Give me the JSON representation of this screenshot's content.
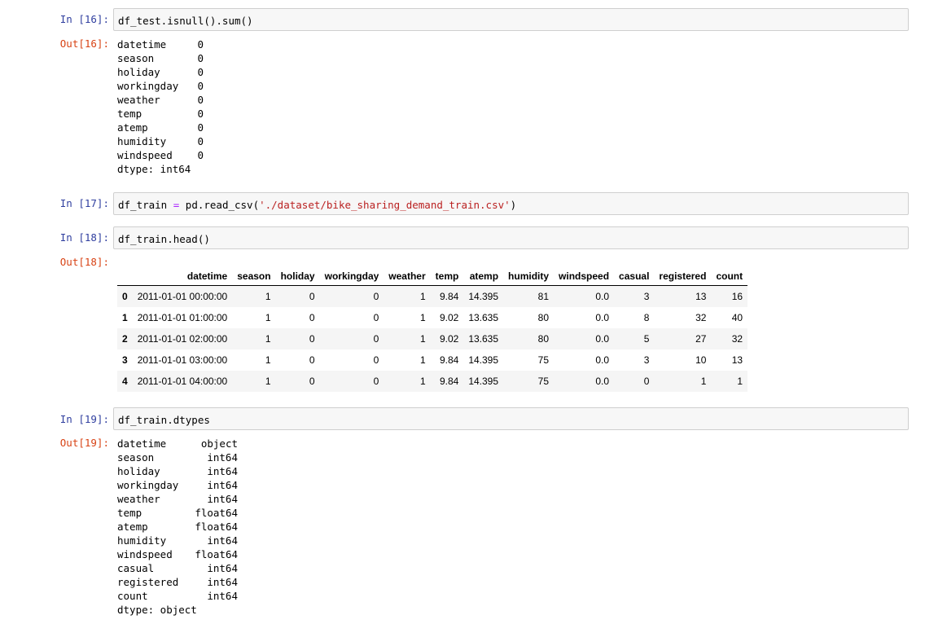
{
  "cells": {
    "c16": {
      "in_prompt": "In [16]:",
      "code": "df_test.isnull().sum()",
      "out_prompt": "Out[16]:",
      "rows": [
        {
          "k": "datetime",
          "v": "0"
        },
        {
          "k": "season",
          "v": "0"
        },
        {
          "k": "holiday",
          "v": "0"
        },
        {
          "k": "workingday",
          "v": "0"
        },
        {
          "k": "weather",
          "v": "0"
        },
        {
          "k": "temp",
          "v": "0"
        },
        {
          "k": "atemp",
          "v": "0"
        },
        {
          "k": "humidity",
          "v": "0"
        },
        {
          "k": "windspeed",
          "v": "0"
        }
      ],
      "dtype": "dtype: int64"
    },
    "c17": {
      "in_prompt": "In [17]:",
      "code_var": "df_train",
      "code_eq": " = ",
      "code_call": "pd.read_csv(",
      "code_str": "'./dataset/bike_sharing_demand_train.csv'",
      "code_close": ")"
    },
    "c18": {
      "in_prompt": "In [18]:",
      "code": "df_train.head()",
      "out_prompt": "Out[18]:",
      "columns": [
        "",
        "datetime",
        "season",
        "holiday",
        "workingday",
        "weather",
        "temp",
        "atemp",
        "humidity",
        "windspeed",
        "casual",
        "registered",
        "count"
      ],
      "rows": [
        [
          "0",
          "2011-01-01 00:00:00",
          "1",
          "0",
          "0",
          "1",
          "9.84",
          "14.395",
          "81",
          "0.0",
          "3",
          "13",
          "16"
        ],
        [
          "1",
          "2011-01-01 01:00:00",
          "1",
          "0",
          "0",
          "1",
          "9.02",
          "13.635",
          "80",
          "0.0",
          "8",
          "32",
          "40"
        ],
        [
          "2",
          "2011-01-01 02:00:00",
          "1",
          "0",
          "0",
          "1",
          "9.02",
          "13.635",
          "80",
          "0.0",
          "5",
          "27",
          "32"
        ],
        [
          "3",
          "2011-01-01 03:00:00",
          "1",
          "0",
          "0",
          "1",
          "9.84",
          "14.395",
          "75",
          "0.0",
          "3",
          "10",
          "13"
        ],
        [
          "4",
          "2011-01-01 04:00:00",
          "1",
          "0",
          "0",
          "1",
          "9.84",
          "14.395",
          "75",
          "0.0",
          "0",
          "1",
          "1"
        ]
      ]
    },
    "c19": {
      "in_prompt": "In [19]:",
      "code": "df_train.dtypes",
      "out_prompt": "Out[19]:",
      "rows": [
        {
          "k": "datetime",
          "v": "object"
        },
        {
          "k": "season",
          "v": "int64"
        },
        {
          "k": "holiday",
          "v": "int64"
        },
        {
          "k": "workingday",
          "v": "int64"
        },
        {
          "k": "weather",
          "v": "int64"
        },
        {
          "k": "temp",
          "v": "float64"
        },
        {
          "k": "atemp",
          "v": "float64"
        },
        {
          "k": "humidity",
          "v": "int64"
        },
        {
          "k": "windspeed",
          "v": "float64"
        },
        {
          "k": "casual",
          "v": "int64"
        },
        {
          "k": "registered",
          "v": "int64"
        },
        {
          "k": "count",
          "v": "int64"
        }
      ],
      "dtype": "dtype: object"
    }
  },
  "colors": {
    "in_prompt": "#303F9F",
    "out_prompt": "#D84315",
    "string": "#BA2121",
    "operator": "#AA22FF",
    "input_bg": "#f7f7f7"
  }
}
